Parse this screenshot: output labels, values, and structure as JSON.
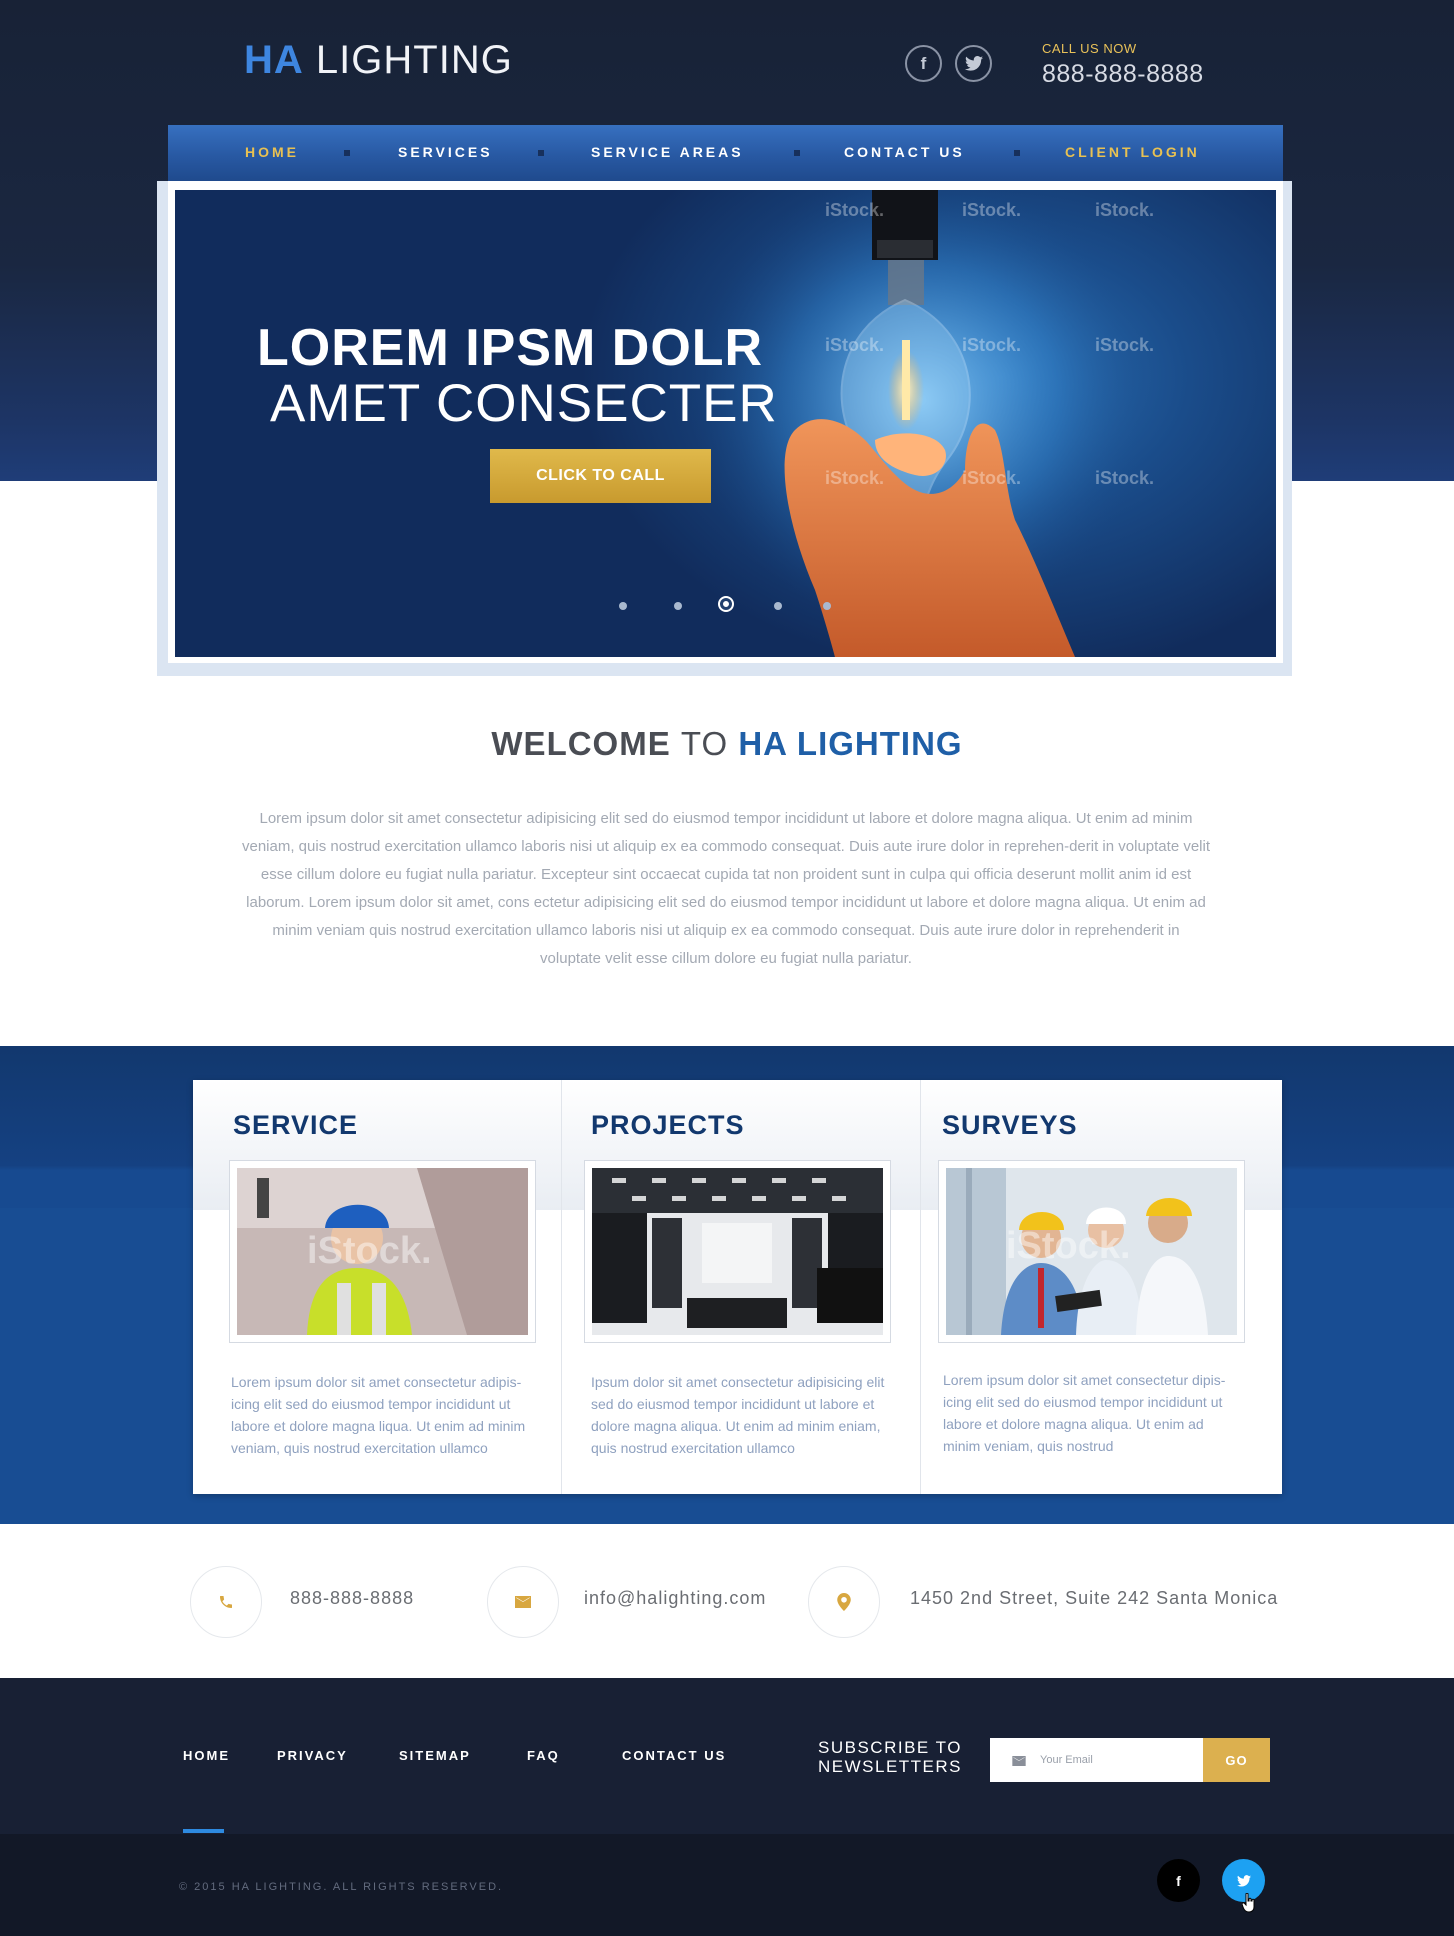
{
  "header": {
    "logo_bold": "HA",
    "logo_rest": "LIGHTING",
    "social": [
      {
        "icon": "facebook-icon",
        "glyph": "f"
      },
      {
        "icon": "twitter-icon",
        "glyph": "t"
      }
    ],
    "call_label": "CALL US NOW",
    "call_number": "888-888-8888"
  },
  "nav": {
    "items": [
      "HOME",
      "SERVICES",
      "SERVICE AREAS",
      "CONTACT US",
      "CLIENT LOGIN"
    ],
    "active": "HOME"
  },
  "hero": {
    "line1": "LOREM IPSM DOLR",
    "line2": "AMET CONSECTER",
    "cta": "CLICK TO CALL",
    "slide_count": 5,
    "active_slide": 3,
    "watermark": "iStock."
  },
  "welcome": {
    "part1": "WELCOME",
    "part2": "TO",
    "part3": "HA LIGHTING",
    "body": "Lorem ipsum dolor sit amet consectetur adipisicing elit sed do eiusmod tempor incididunt ut labore et dolore magna aliqua. Ut enim ad minim veniam, quis nostrud exercitation ullamco laboris nisi ut aliquip ex ea commodo consequat. Duis aute irure dolor in reprehen-derit in voluptate velit esse cillum dolore eu fugiat nulla pariatur. Excepteur sint occaecat cupida tat non proident sunt in culpa qui officia deserunt mollit anim id est laborum. Lorem ipsum dolor sit amet, cons ectetur adipisicing elit sed do eiusmod tempor incididunt ut labore et dolore magna aliqua. Ut enim ad minim veniam quis nostrud exercitation ullamco laboris nisi ut aliquip ex ea commodo consequat. Duis aute irure dolor in reprehenderit in voluptate velit esse cillum dolore eu fugiat nulla pariatur."
  },
  "cards": [
    {
      "title": "SERVICE",
      "text": "Lorem ipsum dolor sit amet  consectetur adipis-icing elit sed do eiusmod tempor incididunt ut labore et dolore magna liqua. Ut enim ad minim veniam, quis nostrud exercitation ullamco"
    },
    {
      "title": "PROJECTS",
      "text": "Ipsum dolor sit amet consectetur adipisicing elit sed do eiusmod tempor incididunt ut labore et dolore magna aliqua. Ut enim ad minim eniam, quis nostrud exercitation ullamco"
    },
    {
      "title": "SURVEYS",
      "text": "Lorem ipsum dolor sit amet consectetur dipis-icing elit sed do eiusmod tempor incididunt ut labore et dolore magna aliqua. Ut enim ad minim veniam, quis nostrud"
    }
  ],
  "contact": {
    "phone": "888-888-8888",
    "email": "info@halighting.com",
    "address": "1450 2nd Street, Suite 242  Santa Monica"
  },
  "footer": {
    "links": [
      "HOME",
      "PRIVACY",
      "SITEMAP",
      "FAQ",
      "CONTACT US"
    ],
    "active": "HOME",
    "subscribe_line1": "SUBSCRIBE TO",
    "subscribe_line2": "NEWSLETTERS",
    "email_placeholder": "Your Email",
    "go": "GO",
    "copyright": "© 2015 HA LIGHTING. ALL RIGHTS RESERVED.",
    "social": [
      {
        "icon": "facebook-icon",
        "glyph": "f",
        "color": "#000000"
      },
      {
        "icon": "twitter-icon",
        "glyph": "t",
        "color": "#1da1f2"
      }
    ]
  },
  "colors": {
    "accent_gold": "#e8c152",
    "brand_blue": "#1f5fa7",
    "dark_navy": "#182034"
  }
}
